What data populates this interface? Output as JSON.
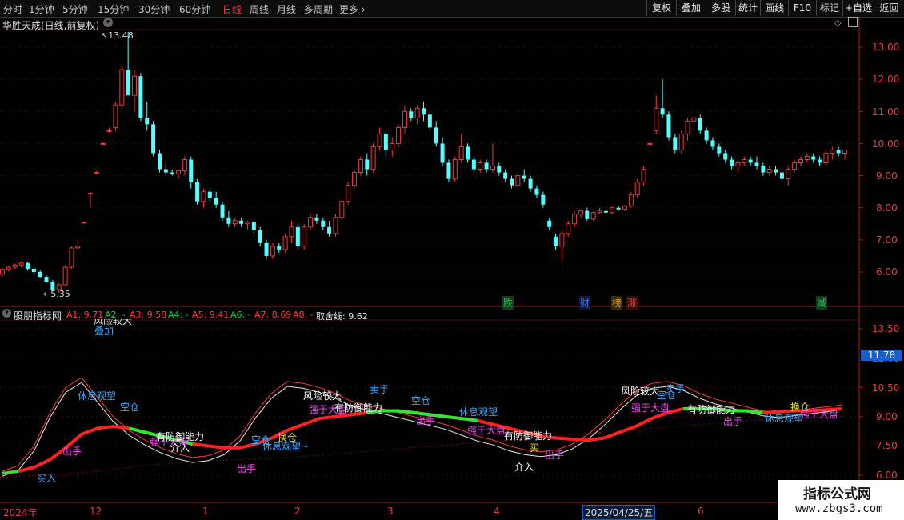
{
  "toolbar": {
    "timeframes": [
      "分时",
      "1分钟",
      "5分钟",
      "15分钟",
      "30分钟",
      "60分钟",
      "日线",
      "周线",
      "月线",
      "多周期",
      "更多"
    ],
    "active": "日线",
    "right_buttons": [
      "复权",
      "叠加",
      "多股",
      "统计",
      "画线",
      "F10",
      "标记",
      "+自选",
      "返回"
    ]
  },
  "main_title": "华胜天成(日线,前复权)",
  "price_axis": [
    "13.00",
    "12.00",
    "11.00",
    "10.00",
    "9.00",
    "8.00",
    "7.00",
    "6.00"
  ],
  "price_high_label": "13.48",
  "price_low_label": "5.35",
  "event_tags": [
    {
      "text": "跌",
      "color": "#22c060"
    },
    {
      "text": "财",
      "color": "#3a6cff"
    },
    {
      "text": "榜",
      "color": "#e0a020"
    },
    {
      "text": "涨",
      "color": "#ff3b3b"
    },
    {
      "text": "减",
      "color": "#22c060"
    }
  ],
  "indicator": {
    "name": "股朋指标网",
    "values": [
      {
        "text": "A1: 9.71",
        "color": "#ff3b3b"
      },
      {
        "text": "A2: -",
        "color": "#22d040"
      },
      {
        "text": "A3: 9.58",
        "color": "#ff3b3b"
      },
      {
        "text": "A4: -",
        "color": "#22d040"
      },
      {
        "text": "A5: 9.41",
        "color": "#ff3b3b"
      },
      {
        "text": "A6: -",
        "color": "#22d040"
      },
      {
        "text": "A7: 8.69",
        "color": "#ff3b3b"
      },
      {
        "text": "A8: -",
        "color": "#ff3b3b"
      },
      {
        "text": "取舍线: 9.62",
        "color": "#e6e6e6"
      }
    ],
    "axis": [
      "13.50",
      "12.00",
      "10.50",
      "9.00",
      "7.50",
      "6.00"
    ],
    "current_value": "11.78",
    "clipped_text": "风险较大",
    "signals": [
      {
        "text": "休息观望",
        "color": "#37a8ff"
      },
      {
        "text": "出手",
        "color": "#ff44ff"
      },
      {
        "text": "强于大盘",
        "color": "#ff44ff"
      },
      {
        "text": "有防御能力",
        "color": "#ffffff"
      },
      {
        "text": "介入",
        "color": "#ffffff"
      },
      {
        "text": "空仓",
        "color": "#37a8ff"
      },
      {
        "text": "买入",
        "color": "#37a8ff"
      },
      {
        "text": "出手",
        "color": "#ff44ff"
      },
      {
        "text": "空仓",
        "color": "#37a8ff"
      },
      {
        "text": "换仓",
        "color": "#e8e020"
      },
      {
        "text": "休息观望~",
        "color": "#37a8ff"
      },
      {
        "text": "风险较大",
        "color": "#ffffff"
      },
      {
        "text": "强于大盘",
        "color": "#ff44ff"
      },
      {
        "text": "有防御能力",
        "color": "#ffffff"
      },
      {
        "text": "卖手",
        "color": "#37a8ff"
      },
      {
        "text": "空仓",
        "color": "#37a8ff"
      },
      {
        "text": "出手",
        "color": "#ff44ff"
      },
      {
        "text": "休息观望",
        "color": "#37a8ff"
      },
      {
        "text": "强于大盘",
        "color": "#ff44ff"
      },
      {
        "text": "有防御能力",
        "color": "#ffffff"
      },
      {
        "text": "买",
        "color": "#e8e020"
      },
      {
        "text": "出手",
        "color": "#ff44ff"
      },
      {
        "text": "介入",
        "color": "#ffffff"
      },
      {
        "text": "风险较大",
        "color": "#ffffff"
      },
      {
        "text": "卖手",
        "color": "#37a8ff"
      },
      {
        "text": "空仓",
        "color": "#37a8ff"
      },
      {
        "text": "强于大盘",
        "color": "#ff44ff"
      },
      {
        "text": "有防御能力",
        "color": "#ffffff"
      },
      {
        "text": "出手",
        "color": "#ff44ff"
      },
      {
        "text": "休息观望",
        "color": "#37a8ff"
      },
      {
        "text": "换仓",
        "color": "#e8e020"
      },
      {
        "text": "强于大盘",
        "color": "#ff44ff"
      }
    ]
  },
  "date_axis": [
    "2024年",
    "12",
    "1",
    "2",
    "3",
    "4",
    "2025/04/25/五",
    "6"
  ],
  "watermark": {
    "line1": "指标公式网",
    "line2": "www.zbgs3.com"
  },
  "chart_data": {
    "type": "candlestick",
    "title": "华胜天成(日线,前复权)",
    "price_range": [
      5.0,
      13.9
    ],
    "candles": [
      [
        5.93,
        6.12,
        5.85,
        6.08
      ],
      [
        6.08,
        6.18,
        6.0,
        6.15
      ],
      [
        6.15,
        6.26,
        6.1,
        6.22
      ],
      [
        6.22,
        6.32,
        6.15,
        6.28
      ],
      [
        6.28,
        6.32,
        6.05,
        6.1
      ],
      [
        6.1,
        6.15,
        5.95,
        6.0
      ],
      [
        6.0,
        6.05,
        5.8,
        5.85
      ],
      [
        5.85,
        5.9,
        5.65,
        5.7
      ],
      [
        5.7,
        5.75,
        5.4,
        5.45
      ],
      [
        5.45,
        5.65,
        5.35,
        5.6
      ],
      [
        5.6,
        6.2,
        5.55,
        6.15
      ],
      [
        6.15,
        6.8,
        6.1,
        6.75
      ],
      [
        6.75,
        7.0,
        6.7,
        6.8
      ],
      [
        7.55,
        7.58,
        7.5,
        7.55
      ],
      [
        8.45,
        8.5,
        8.0,
        8.45
      ],
      [
        9.1,
        9.15,
        9.05,
        9.1
      ],
      [
        10.0,
        10.05,
        9.98,
        10.0
      ],
      [
        10.4,
        10.5,
        10.35,
        10.4
      ],
      [
        10.5,
        11.3,
        10.4,
        11.2
      ],
      [
        11.2,
        12.4,
        11.1,
        12.3
      ],
      [
        12.3,
        13.48,
        12.2,
        11.5
      ],
      [
        11.5,
        12.3,
        11.0,
        12.1
      ],
      [
        12.1,
        12.2,
        10.7,
        10.8
      ],
      [
        10.8,
        11.3,
        10.4,
        10.6
      ],
      [
        10.6,
        10.7,
        9.6,
        9.7
      ],
      [
        9.7,
        9.8,
        9.1,
        9.2
      ],
      [
        9.2,
        9.4,
        9.0,
        9.1
      ],
      [
        9.1,
        9.2,
        9.0,
        9.05
      ],
      [
        9.05,
        9.2,
        8.9,
        9.15
      ],
      [
        9.15,
        9.6,
        9.0,
        9.5
      ],
      [
        9.5,
        9.6,
        8.6,
        8.8
      ],
      [
        8.8,
        8.9,
        8.1,
        8.2
      ],
      [
        8.2,
        8.6,
        8.0,
        8.5
      ],
      [
        8.5,
        8.6,
        8.2,
        8.3
      ],
      [
        8.3,
        8.5,
        8.0,
        8.1
      ],
      [
        8.1,
        8.2,
        7.6,
        7.7
      ],
      [
        7.7,
        7.9,
        7.4,
        7.5
      ],
      [
        7.5,
        7.7,
        7.4,
        7.6
      ],
      [
        7.6,
        7.7,
        7.4,
        7.5
      ],
      [
        7.5,
        7.6,
        7.3,
        7.55
      ],
      [
        7.55,
        7.6,
        7.2,
        7.3
      ],
      [
        7.3,
        7.4,
        6.8,
        6.9
      ],
      [
        6.9,
        7.0,
        6.4,
        6.5
      ],
      [
        6.5,
        6.9,
        6.4,
        6.8
      ],
      [
        6.8,
        6.9,
        6.6,
        6.7
      ],
      [
        6.7,
        7.2,
        6.6,
        7.1
      ],
      [
        7.1,
        7.6,
        6.9,
        7.4
      ],
      [
        7.4,
        7.5,
        6.7,
        6.8
      ],
      [
        6.8,
        7.5,
        6.7,
        7.4
      ],
      [
        7.4,
        7.8,
        7.3,
        7.7
      ],
      [
        7.7,
        7.8,
        7.5,
        7.6
      ],
      [
        7.6,
        7.7,
        7.3,
        7.4
      ],
      [
        7.4,
        7.6,
        7.1,
        7.2
      ],
      [
        7.2,
        7.8,
        7.1,
        7.7
      ],
      [
        7.7,
        8.3,
        7.6,
        8.2
      ],
      [
        8.2,
        8.8,
        8.1,
        8.7
      ],
      [
        8.7,
        9.2,
        8.6,
        9.1
      ],
      [
        9.1,
        9.6,
        9.0,
        9.5
      ],
      [
        9.5,
        9.7,
        9.0,
        9.2
      ],
      [
        9.2,
        10.0,
        9.1,
        9.9
      ],
      [
        9.9,
        10.5,
        9.8,
        10.3
      ],
      [
        10.3,
        10.4,
        9.6,
        9.8
      ],
      [
        9.8,
        10.2,
        9.6,
        10.0
      ],
      [
        10.0,
        10.6,
        9.9,
        10.5
      ],
      [
        10.5,
        11.2,
        10.3,
        11.0
      ],
      [
        11.0,
        11.1,
        10.7,
        10.8
      ],
      [
        10.8,
        11.2,
        10.6,
        11.1
      ],
      [
        11.1,
        11.3,
        10.7,
        10.9
      ],
      [
        10.9,
        11.0,
        10.4,
        10.5
      ],
      [
        10.5,
        10.7,
        9.9,
        10.0
      ],
      [
        10.0,
        10.2,
        9.3,
        9.4
      ],
      [
        9.4,
        9.5,
        8.8,
        8.9
      ],
      [
        8.9,
        9.6,
        8.8,
        9.5
      ],
      [
        9.5,
        10.3,
        9.4,
        9.9
      ],
      [
        9.9,
        10.0,
        9.4,
        9.5
      ],
      [
        9.5,
        9.6,
        9.1,
        9.2
      ],
      [
        9.2,
        9.5,
        9.1,
        9.4
      ],
      [
        9.4,
        9.5,
        9.1,
        9.2
      ],
      [
        9.2,
        10.0,
        9.1,
        9.3
      ],
      [
        9.3,
        9.4,
        9.0,
        9.1
      ],
      [
        9.1,
        9.2,
        8.8,
        8.9
      ],
      [
        8.9,
        9.0,
        8.6,
        8.7
      ],
      [
        8.7,
        9.1,
        8.6,
        9.0
      ],
      [
        9.0,
        9.2,
        8.8,
        8.9
      ],
      [
        8.9,
        9.0,
        8.5,
        8.6
      ],
      [
        8.6,
        8.7,
        8.3,
        8.4
      ],
      [
        8.4,
        8.5,
        8.0,
        8.1
      ],
      [
        7.6,
        7.7,
        7.3,
        7.4
      ],
      [
        7.1,
        7.2,
        6.7,
        6.8
      ],
      [
        6.8,
        7.3,
        6.3,
        7.2
      ],
      [
        7.2,
        7.6,
        7.1,
        7.5
      ],
      [
        7.5,
        7.9,
        7.4,
        7.8
      ],
      [
        7.8,
        7.95,
        7.7,
        7.9
      ],
      [
        7.9,
        8.0,
        7.6,
        7.65
      ],
      [
        7.65,
        7.9,
        7.6,
        7.85
      ],
      [
        7.85,
        8.0,
        7.8,
        7.9
      ],
      [
        7.9,
        7.95,
        7.8,
        7.85
      ],
      [
        7.85,
        8.05,
        7.8,
        8.0
      ],
      [
        8.0,
        8.05,
        7.9,
        7.95
      ],
      [
        7.95,
        8.1,
        7.9,
        8.05
      ],
      [
        8.05,
        8.5,
        8.0,
        8.4
      ],
      [
        8.4,
        8.9,
        8.3,
        8.8
      ],
      [
        8.8,
        9.3,
        8.7,
        9.2
      ],
      [
        10.0,
        10.05,
        9.98,
        10.0
      ],
      [
        10.4,
        11.5,
        10.3,
        11.1
      ],
      [
        11.1,
        12.0,
        10.8,
        10.9
      ],
      [
        10.9,
        11.0,
        10.1,
        10.2
      ],
      [
        10.2,
        10.3,
        9.7,
        9.8
      ],
      [
        9.8,
        10.4,
        9.7,
        10.3
      ],
      [
        10.3,
        10.8,
        10.1,
        10.7
      ],
      [
        10.7,
        11.0,
        10.4,
        10.8
      ],
      [
        10.8,
        10.9,
        10.3,
        10.4
      ],
      [
        10.4,
        10.5,
        10.0,
        10.1
      ],
      [
        10.1,
        10.2,
        9.8,
        9.9
      ],
      [
        9.9,
        10.0,
        9.6,
        9.7
      ],
      [
        9.7,
        9.8,
        9.4,
        9.5
      ],
      [
        9.5,
        9.6,
        9.2,
        9.3
      ],
      [
        9.3,
        9.5,
        9.1,
        9.4
      ],
      [
        9.4,
        9.6,
        9.3,
        9.5
      ],
      [
        9.5,
        9.6,
        9.3,
        9.4
      ],
      [
        9.4,
        9.6,
        9.2,
        9.3
      ],
      [
        9.3,
        9.4,
        9.0,
        9.1
      ],
      [
        9.1,
        9.3,
        9.0,
        9.2
      ],
      [
        9.2,
        9.3,
        9.0,
        9.1
      ],
      [
        9.1,
        9.2,
        8.8,
        8.9
      ],
      [
        8.9,
        9.3,
        8.7,
        9.2
      ],
      [
        9.2,
        9.5,
        9.1,
        9.4
      ],
      [
        9.4,
        9.6,
        9.3,
        9.5
      ],
      [
        9.5,
        9.7,
        9.4,
        9.6
      ],
      [
        9.6,
        9.7,
        9.4,
        9.5
      ],
      [
        9.5,
        9.6,
        9.3,
        9.4
      ],
      [
        9.4,
        9.8,
        9.3,
        9.7
      ],
      [
        9.7,
        9.9,
        9.5,
        9.8
      ],
      [
        9.8,
        9.9,
        9.6,
        9.7
      ],
      [
        9.7,
        9.8,
        9.5,
        9.8
      ]
    ],
    "indicator_range": [
      5.6,
      14.2
    ],
    "indicator_series": {
      "slow_red": [
        6.1,
        6.2,
        6.4,
        6.8,
        7.4,
        8.1,
        8.4,
        8.5,
        8.4,
        8.2,
        8.0,
        7.8,
        7.6,
        7.5,
        7.4,
        7.4,
        7.6,
        7.9,
        8.3,
        8.6,
        8.9,
        9.0,
        9.1,
        9.2,
        9.3,
        9.3,
        9.2,
        9.1,
        9.0,
        8.9,
        8.8,
        8.6,
        8.4,
        8.2,
        8.0,
        7.9,
        7.85,
        7.8,
        7.9,
        8.2,
        8.5,
        8.9,
        9.2,
        9.4,
        9.4,
        9.4,
        9.3,
        9.3,
        9.2,
        9.25,
        9.3,
        9.3,
        9.35,
        9.4
      ],
      "fast_white": [
        6.2,
        6.5,
        7.5,
        9.2,
        10.5,
        11.0,
        10.0,
        9.0,
        8.3,
        7.8,
        7.4,
        7.1,
        6.9,
        7.0,
        7.3,
        8.0,
        9.2,
        10.2,
        10.8,
        10.7,
        10.5,
        10.2,
        9.8,
        9.6,
        9.4,
        9.2,
        9.0,
        8.8,
        8.6,
        8.3,
        8.0,
        7.8,
        7.5,
        7.3,
        7.2,
        7.3,
        7.6,
        8.1,
        8.8,
        9.6,
        10.3,
        10.7,
        10.8,
        10.6,
        10.2,
        9.9,
        9.7,
        9.5,
        9.3,
        9.2,
        9.3,
        9.4,
        9.5,
        9.6
      ],
      "dotted_red": [
        5.9,
        5.95,
        6.0,
        6.1,
        6.2,
        6.35,
        6.5,
        6.6,
        6.7,
        6.75,
        6.8,
        6.85,
        6.9,
        7.0,
        7.1,
        7.2,
        7.3,
        7.4,
        7.5,
        7.6,
        7.7,
        7.8,
        7.9,
        8.0,
        8.1,
        8.2,
        8.3,
        8.4,
        8.5,
        8.6,
        8.7,
        8.8,
        8.85,
        8.9,
        8.95,
        9.0
      ]
    }
  }
}
